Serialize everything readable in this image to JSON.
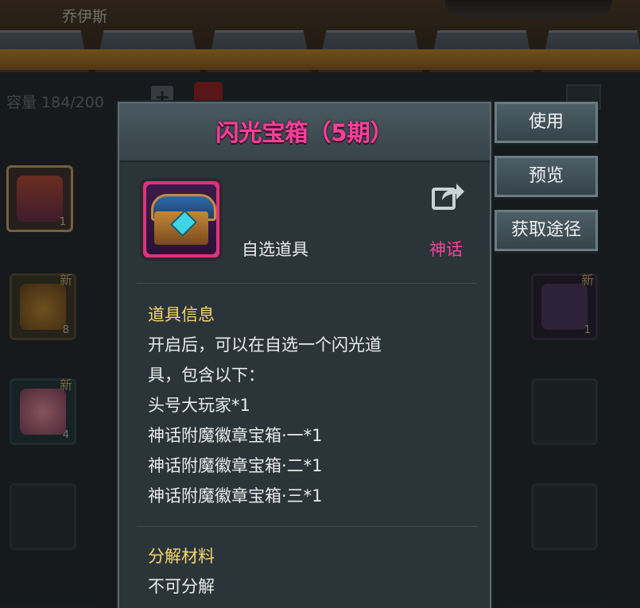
{
  "background": {
    "character_name": "乔伊斯",
    "capacity_text": "容量  184/200",
    "plus_label": "+",
    "inventory": [
      {
        "count": "1",
        "new": ""
      },
      {
        "count": "8",
        "new": "新"
      },
      {
        "count": "1",
        "new": "新"
      },
      {
        "count": "4",
        "new": "新"
      }
    ]
  },
  "popup": {
    "title": "闪光宝箱（5期）",
    "item_type": "自选道具",
    "rarity": "神话",
    "info_title": "道具信息",
    "description_lines": [
      "开启后，可以在自选一个闪光道",
      "具，包含以下：",
      "头号大玩家*1",
      "神话附魔徽章宝箱·一*1",
      "神话附魔徽章宝箱·二*1",
      "神话附魔徽章宝箱·三*1"
    ],
    "decompose_title": "分解材料",
    "decompose_text": "不可分解"
  },
  "actions": {
    "use_label": "使用",
    "preview_label": "预览",
    "source_label": "获取途径"
  },
  "colors": {
    "title_pink": "#ff3e9c",
    "section_yellow": "#f7d56b",
    "panel_bg": "#2b3539"
  },
  "icons": [
    "share-icon",
    "treasure-chest-icon",
    "question-mark-icon",
    "jar-icon"
  ]
}
